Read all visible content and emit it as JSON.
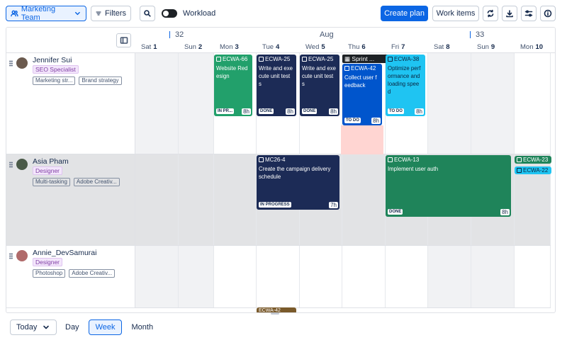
{
  "toolbar": {
    "team": "Marketing Team",
    "filters": "Filters",
    "workload": "Workload",
    "create_plan": "Create plan",
    "work_items": "Work items"
  },
  "header": {
    "week1": "32",
    "week2": "33",
    "month": "Aug",
    "days": [
      {
        "w": "Sat",
        "d": "1"
      },
      {
        "w": "Sun",
        "d": "2"
      },
      {
        "w": "Mon",
        "d": "3"
      },
      {
        "w": "Tue",
        "d": "4"
      },
      {
        "w": "Wed",
        "d": "5"
      },
      {
        "w": "Thu",
        "d": "6"
      },
      {
        "w": "Fri",
        "d": "7"
      },
      {
        "w": "Sat",
        "d": "8"
      },
      {
        "w": "Sun",
        "d": "9"
      },
      {
        "w": "Mon",
        "d": "10"
      }
    ]
  },
  "people": [
    {
      "name": "Jennifer Sui",
      "role": "SEO Specialist",
      "skills": [
        "Marketing str...",
        "Brand strategy"
      ],
      "avatar": "#6b5a4e"
    },
    {
      "name": "Asia Pham",
      "role": "Designer",
      "skills": [
        "Multi-tasking",
        "Adobe Creativ..."
      ],
      "avatar": "#4a5a48"
    },
    {
      "name": "Annie_DevSamurai",
      "role": "Designer",
      "skills": [
        "Photoshop",
        "Adobe Creativ..."
      ],
      "avatar": "#b06a6a"
    }
  ],
  "cards": {
    "c1": {
      "key": "ECWA-66",
      "title": "Website Red esign",
      "status": "IN PR...",
      "hours": "8h"
    },
    "c2": {
      "key": "ECWA-25",
      "title": "Write and exe cute unit test s",
      "status": "DONE",
      "hours": "8h"
    },
    "c3": {
      "key": "ECWA-25",
      "title": "Write and exe cute unit test s",
      "status": "DONE",
      "hours": "8h"
    },
    "c4": {
      "key": "ECWA-42",
      "title": "Collect user f eedback",
      "status": "TO DO",
      "hours": "8h"
    },
    "c5": {
      "key": "ECWA-38",
      "title": "Optimize perf ormance and loading spee d",
      "status": "TO DO",
      "hours": "8h"
    },
    "c6": {
      "key": "MC26-4",
      "title": "Create the campaign delivery schedule",
      "status": "IN PROGRESS",
      "hours": "7h"
    },
    "c7": {
      "key": "ECWA-13",
      "title": "Implement user auth",
      "status": "DONE",
      "hours": "8h"
    },
    "c8": {
      "key": "ECWA-23"
    },
    "c9": {
      "key": "ECWA-22"
    },
    "c10": {
      "key": "ECWA-42"
    }
  },
  "sprint": "Sprint ...",
  "footer": {
    "today": "Today",
    "day": "Day",
    "week": "Week",
    "month": "Month"
  }
}
